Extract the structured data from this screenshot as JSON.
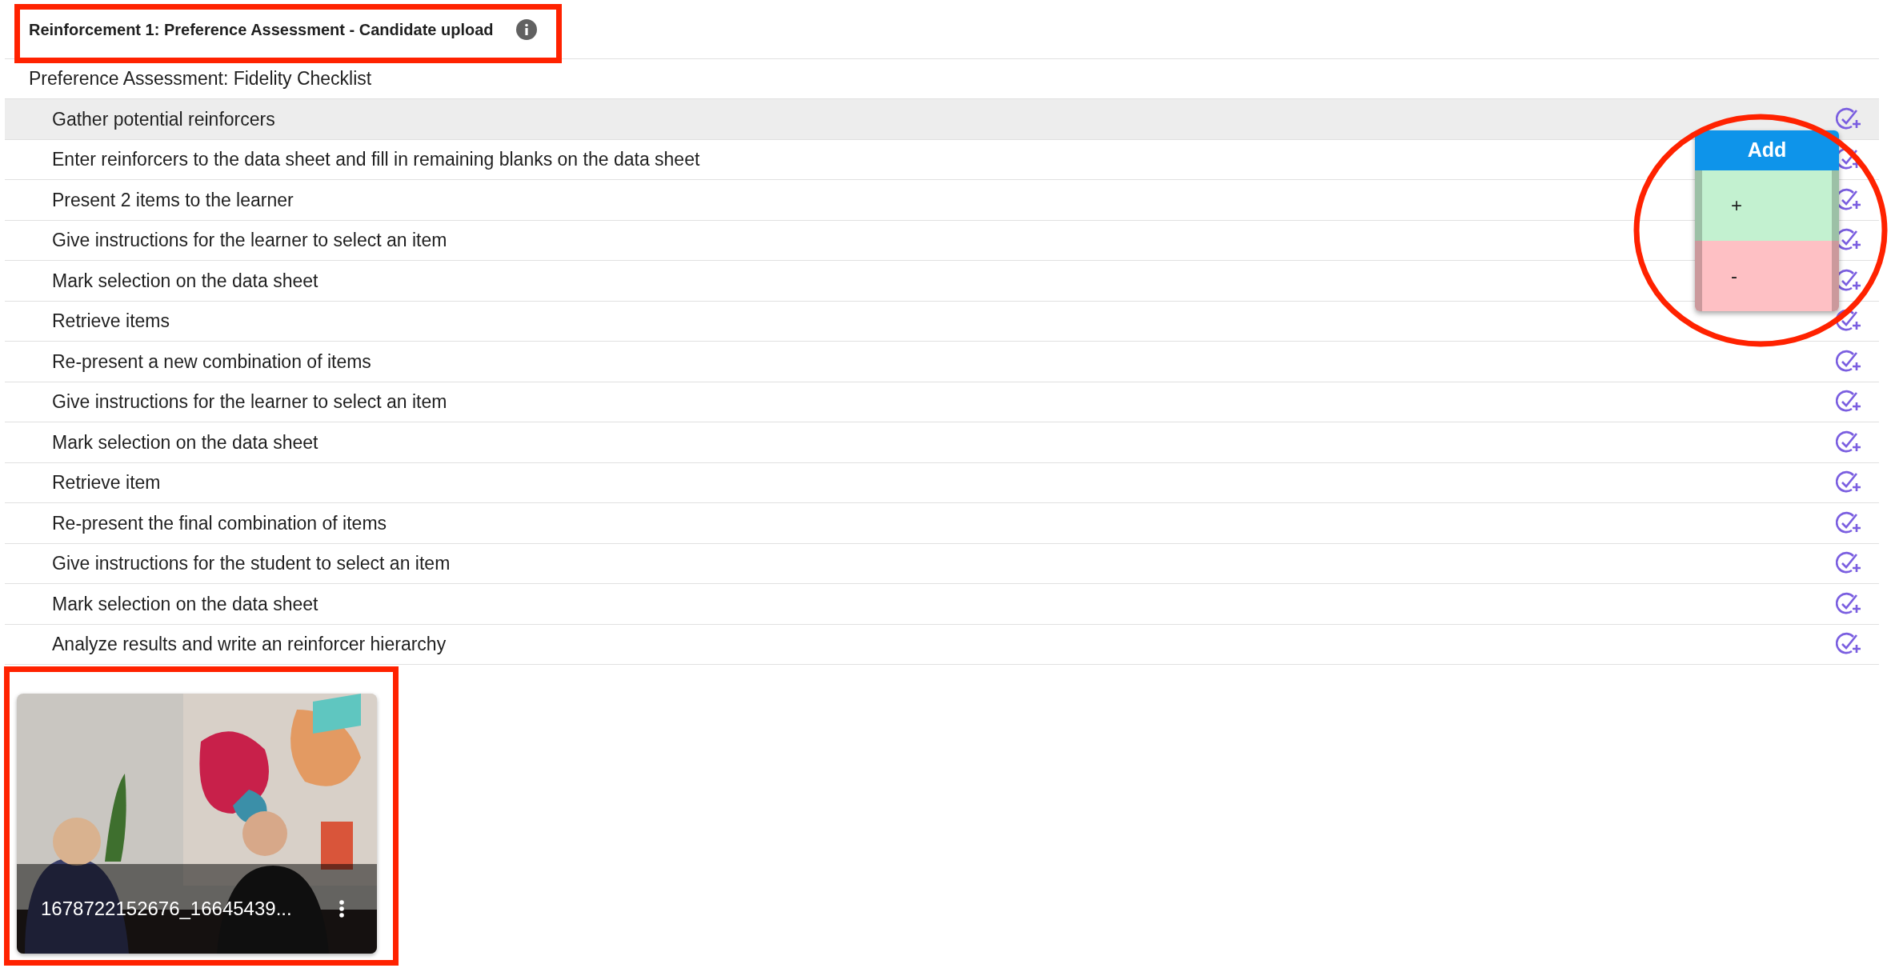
{
  "header": {
    "title": "Reinforcement 1: Preference Assessment - Candidate upload"
  },
  "checklist": {
    "title": "Preference Assessment: Fidelity Checklist",
    "items": [
      {
        "label": "Gather potential reinforcers",
        "highlighted": true
      },
      {
        "label": "Enter reinforcers to the data sheet and fill in remaining blanks on the data sheet",
        "highlighted": false
      },
      {
        "label": "Present 2 items to the learner",
        "highlighted": false
      },
      {
        "label": "Give instructions for the learner to select an item",
        "highlighted": false
      },
      {
        "label": "Mark selection on the data sheet",
        "highlighted": false
      },
      {
        "label": "Retrieve items",
        "highlighted": false
      },
      {
        "label": "Re-present a new combination of items",
        "highlighted": false
      },
      {
        "label": "Give instructions for the learner to select an item",
        "highlighted": false
      },
      {
        "label": "Mark selection on the data sheet",
        "highlighted": false
      },
      {
        "label": "Retrieve item",
        "highlighted": false
      },
      {
        "label": "Re-present the final combination of items",
        "highlighted": false
      },
      {
        "label": "Give instructions for the student to select an item",
        "highlighted": false
      },
      {
        "label": "Mark selection on the data sheet",
        "highlighted": false
      },
      {
        "label": "Analyze results and write an reinforcer hierarchy",
        "highlighted": false
      }
    ]
  },
  "add_menu": {
    "title": "Add",
    "options": [
      {
        "label": "+",
        "color": "#c3f1d0"
      },
      {
        "label": "-",
        "color": "#fec0c4"
      }
    ]
  },
  "video": {
    "kind": "picture",
    "filename": "1678722152676_16645439..."
  }
}
